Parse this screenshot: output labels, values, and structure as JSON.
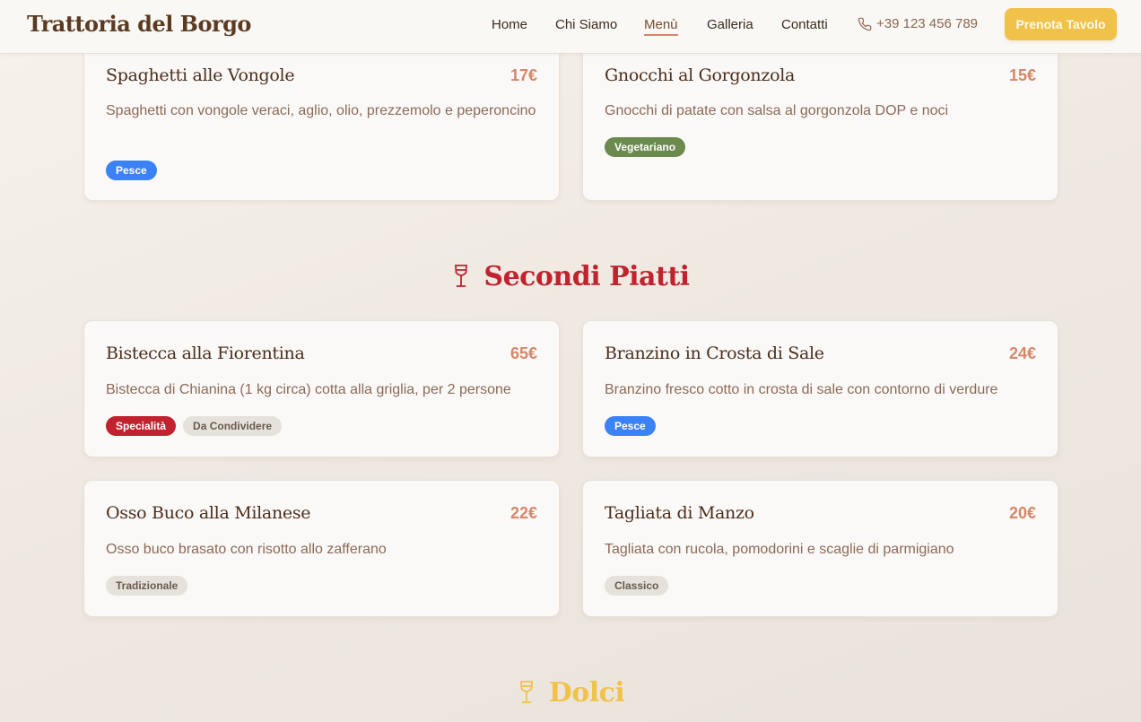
{
  "header": {
    "brand": "Trattoria del Borgo",
    "nav": [
      "Home",
      "Chi Siamo",
      "Menù",
      "Galleria",
      "Contatti"
    ],
    "active_nav": "Menù",
    "phone": "+39 123 456 789",
    "cta": "Prenota Tavolo"
  },
  "colors": {
    "brand_brown": "#5b3a22",
    "accent_red": "#c0232f",
    "accent_gold": "#f0c24a",
    "price": "#d4876a"
  },
  "primi": [
    {
      "title": "Spaghetti alle Vongole",
      "price": "17€",
      "desc": "Spaghetti con vongole veraci, aglio, olio, prezzemolo e peperoncino",
      "tags": [
        "Pesce"
      ]
    },
    {
      "title": "Gnocchi al Gorgonzola",
      "price": "15€",
      "desc": "Gnocchi di patate con salsa al gorgonzola DOP e noci",
      "tags": [
        "Vegetariano"
      ]
    }
  ],
  "secondi": {
    "title": "Secondi Piatti",
    "icon": "wine-glass-icon",
    "items": [
      {
        "title": "Bistecca alla Fiorentina",
        "price": "65€",
        "desc": "Bistecca di Chianina (1 kg circa) cotta alla griglia, per 2 persone",
        "tags": [
          "Specialità",
          "Da Condividere"
        ]
      },
      {
        "title": "Branzino in Crosta di Sale",
        "price": "24€",
        "desc": "Branzino fresco cotto in crosta di sale con contorno di verdure",
        "tags": [
          "Pesce"
        ]
      },
      {
        "title": "Osso Buco alla Milanese",
        "price": "22€",
        "desc": "Osso buco brasato con risotto allo zafferano",
        "tags": [
          "Tradizionale"
        ]
      },
      {
        "title": "Tagliata di Manzo",
        "price": "20€",
        "desc": "Tagliata con rucola, pomodorini e scaglie di parmigiano",
        "tags": [
          "Classico"
        ]
      }
    ]
  },
  "dolci": {
    "title": "Dolci",
    "icon": "wine-glass-icon"
  }
}
